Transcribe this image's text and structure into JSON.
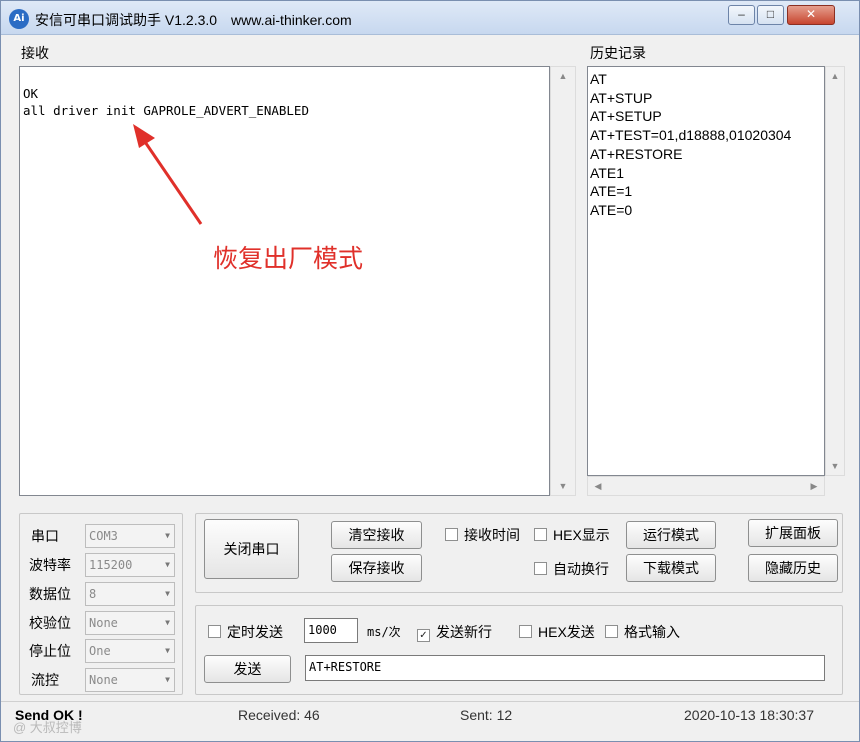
{
  "window": {
    "app_icon": "Ai",
    "title": "安信可串口调试助手 V1.2.3.0",
    "url": "www.ai-thinker.com",
    "controls": {
      "minimize": "–",
      "maximize": "□",
      "close": "✕"
    }
  },
  "receive": {
    "label": "接收",
    "content": "OK\nall driver init GAPROLE_ADVERT_ENABLED"
  },
  "annotation": {
    "text": "恢复出厂模式",
    "color": "#e0302a"
  },
  "history": {
    "label": "历史记录",
    "items": [
      "AT",
      "AT+STUP",
      "AT+SETUP",
      "AT+TEST=01,d18888,01020304",
      "AT+RESTORE",
      "ATE1",
      "ATE=1",
      "ATE=0"
    ]
  },
  "serial": {
    "port_label": "串口",
    "port_value": "COM3",
    "baud_label": "波特率",
    "baud_value": "115200",
    "databits_label": "数据位",
    "databits_value": "8",
    "parity_label": "校验位",
    "parity_value": "None",
    "stopbits_label": "停止位",
    "stopbits_value": "One",
    "flow_label": "流控",
    "flow_value": "None"
  },
  "controls": {
    "close_port": "关闭串口",
    "clear_receive": "清空接收",
    "save_receive": "保存接收",
    "receive_time": "接收时间",
    "hex_display": "HEX显示",
    "auto_wrap": "自动换行",
    "run_mode": "运行模式",
    "download_mode": "下载模式",
    "expand_panel": "扩展面板",
    "hide_history": "隐藏历史"
  },
  "send": {
    "timed_send": "定时发送",
    "interval_value": "1000",
    "interval_unit": "ms/次",
    "send_newline": "发送新行",
    "hex_send": "HEX发送",
    "format_input": "格式输入",
    "send_button": "发送",
    "send_value": "AT+RESTORE"
  },
  "status": {
    "message": "Send OK !",
    "received": "Received: 46",
    "sent": "Sent: 12",
    "datetime": "2020-10-13 18:30:37"
  },
  "watermark": "@ 大叔控博"
}
